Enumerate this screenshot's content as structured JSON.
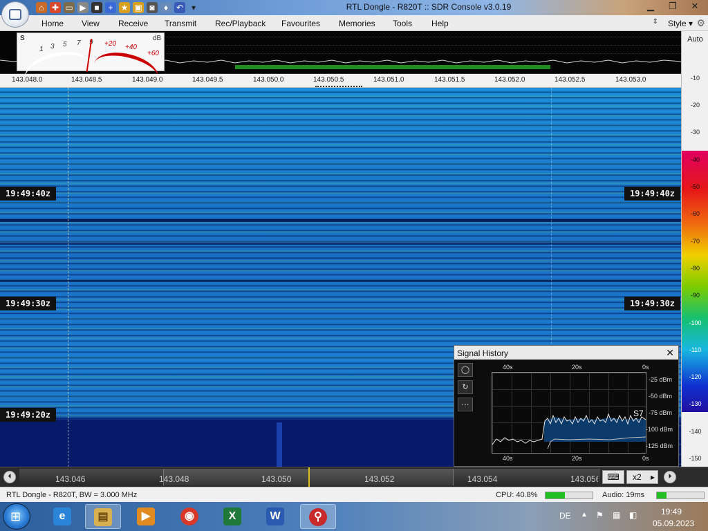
{
  "window": {
    "title": "RTL Dongle - R820T :: SDR Console v3.0.19"
  },
  "menu": {
    "items": [
      "Home",
      "View",
      "Receive",
      "Transmit",
      "Rec/Playback",
      "Favourites",
      "Memories",
      "Tools",
      "Help"
    ],
    "style_label": "Style"
  },
  "smeter": {
    "s_label": "S",
    "db_label": "dB",
    "s_scale": [
      "1",
      "3",
      "5",
      "7",
      "9"
    ],
    "db_scale": [
      "+20",
      "+40",
      "+60"
    ]
  },
  "frequency_axis": {
    "labels": [
      "143.048.0",
      "143.048.5",
      "143.049.0",
      "143.049.5",
      "143.050.0",
      "143.050.5",
      "143.051.0",
      "143.051.5",
      "143.052.0",
      "143.052.5",
      "143.053.0"
    ]
  },
  "scale": {
    "auto_label": "Auto",
    "ticks": [
      "-10",
      "-20",
      "-30",
      "-40",
      "-50",
      "-60",
      "-70",
      "-80",
      "-90",
      "-100",
      "-110",
      "-120",
      "-130",
      "-140",
      "-150"
    ]
  },
  "waterfall": {
    "timestamps": [
      "19:49:40z",
      "19:49:30z",
      "19:49:20z"
    ]
  },
  "signal_history": {
    "title": "Signal History",
    "top_time_labels": [
      "40s",
      "20s",
      "0s"
    ],
    "bottom_time_labels": [
      "40s",
      "20s",
      "0s"
    ],
    "dbm_labels": [
      "-25 dBm",
      "-50 dBm",
      "-75 dBm",
      "-100 dBm",
      "-125 dBm"
    ],
    "s_reading": "S7"
  },
  "bottom_bar": {
    "freq_labels": [
      "143.046",
      "143.048",
      "143.050",
      "143.052",
      "143.054",
      "143.056"
    ],
    "zoom": "x2"
  },
  "status_bar": {
    "device": "RTL Dongle - R820T, BW = 3.000 MHz",
    "cpu": "CPU: 40.8%",
    "cpu_fraction": 0.41,
    "audio": "Audio: 19ms",
    "audio_fraction": 0.2
  },
  "taskbar": {
    "language": "DE",
    "time": "19:49",
    "date": "05.09.2023",
    "icons": [
      "internet-explorer-icon",
      "file-explorer-icon",
      "media-player-icon",
      "chrome-icon",
      "excel-icon",
      "word-icon",
      "sdr-console-icon"
    ]
  },
  "colors": {
    "accent_green": "#22c022",
    "waterfall_blue": "#1b7fd0"
  }
}
